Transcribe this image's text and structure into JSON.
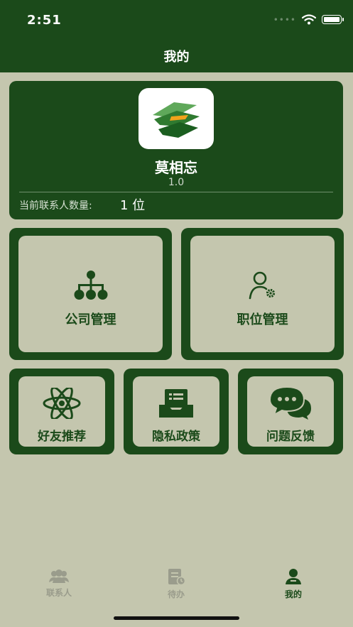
{
  "status_bar": {
    "time": "2:51"
  },
  "header": {
    "title": "我的"
  },
  "app_info": {
    "name": "莫相忘",
    "version": "1.0",
    "contact_count_label": "当前联系人数量:",
    "contact_count_value": "1 位"
  },
  "tiles": {
    "company": {
      "label": "公司管理",
      "icon": "org-chart-icon"
    },
    "position": {
      "label": "职位管理",
      "icon": "user-gear-icon"
    },
    "friends": {
      "label": "好友推荐",
      "icon": "atom-icon"
    },
    "privacy": {
      "label": "隐私政策",
      "icon": "document-tray-icon"
    },
    "feedback": {
      "label": "问题反馈",
      "icon": "chat-bubbles-icon"
    }
  },
  "tabbar": {
    "items": [
      {
        "label": "联系人",
        "icon": "contacts-icon",
        "active": false
      },
      {
        "label": "待办",
        "icon": "todo-icon",
        "active": false
      },
      {
        "label": "我的",
        "icon": "profile-icon",
        "active": true
      }
    ]
  },
  "colors": {
    "brand": "#1b4a1a",
    "background": "#c4c6ae",
    "inactive_tab": "#9a9c8c"
  }
}
